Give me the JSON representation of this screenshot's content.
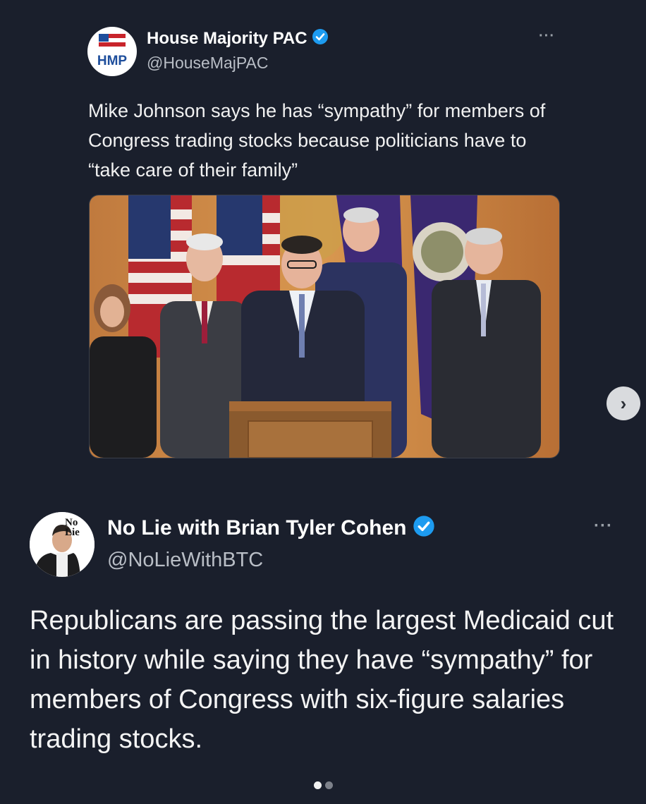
{
  "quoted_tweet": {
    "avatar_label": "HMP",
    "display_name": "House Majority PAC",
    "handle": "@HouseMajPAC",
    "more_label": "···",
    "text": "Mike Johnson says he has “sympathy” for members of Congress trading stocks because politicians have to “take care of their family”"
  },
  "reply_tweet": {
    "avatar_label_1": "No",
    "avatar_label_2": "Lie",
    "display_name": "No Lie with Brian Tyler Cohen",
    "handle": "@NoLieWithBTC",
    "more_label": "···",
    "text": "Republicans are passing the largest Medicaid cut in history while saying they have “sympathy” for members of Congress with six-figure salaries trading stocks."
  },
  "carousel": {
    "next_label": "›",
    "dots": [
      {
        "active": true
      },
      {
        "active": false
      }
    ]
  },
  "colors": {
    "background": "#1a1f2c",
    "verified": "#1d9bf0",
    "hmp_blue": "#1e4e9c",
    "hmp_red": "#c8242b"
  },
  "icons": [
    "verified-badge-icon",
    "more-options-icon",
    "chevron-right-icon",
    "flag-icon"
  ]
}
